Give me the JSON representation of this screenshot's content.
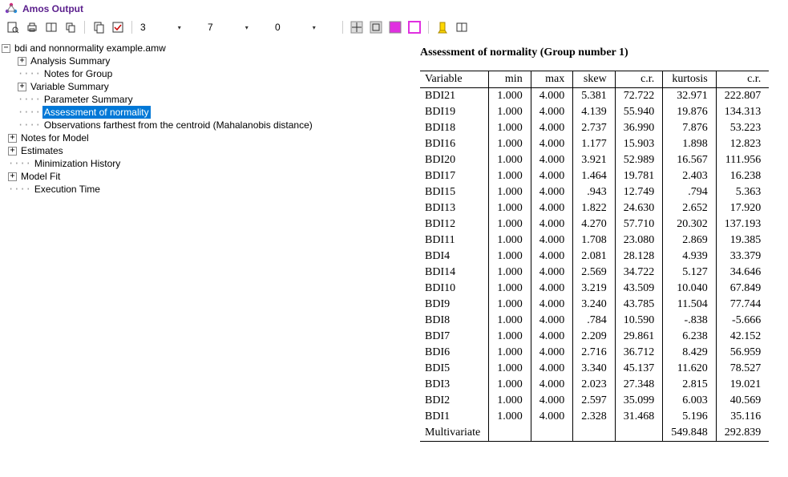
{
  "app": {
    "title": "Amos Output"
  },
  "toolbar": {
    "combo1": "3",
    "combo2": "7",
    "combo3": "0"
  },
  "tree": {
    "root_label": "bdi and nonnormality example.amw",
    "items": [
      {
        "label": "Analysis Summary",
        "indent": 1,
        "exp": "+"
      },
      {
        "label": "Notes for Group",
        "indent": 1,
        "exp": null
      },
      {
        "label": "Variable Summary",
        "indent": 1,
        "exp": "+"
      },
      {
        "label": "Parameter Summary",
        "indent": 1,
        "exp": null
      },
      {
        "label": "Assessment of normality",
        "indent": 1,
        "exp": null,
        "selected": true
      },
      {
        "label": "Observations farthest from the centroid (Mahalanobis distance)",
        "indent": 1,
        "exp": null
      },
      {
        "label": "Notes for Model",
        "indent": 0,
        "exp": "+"
      },
      {
        "label": "Estimates",
        "indent": 0,
        "exp": "+"
      },
      {
        "label": "Minimization History",
        "indent": 0,
        "exp": null
      },
      {
        "label": "Model Fit",
        "indent": 0,
        "exp": "+"
      },
      {
        "label": "Execution Time",
        "indent": 0,
        "exp": null
      }
    ]
  },
  "content": {
    "title": "Assessment of normality (Group number 1)",
    "headers": [
      "Variable",
      "min",
      "max",
      "skew",
      "c.r.",
      "kurtosis",
      "c.r."
    ],
    "rows": [
      [
        "BDI21",
        "1.000",
        "4.000",
        "5.381",
        "72.722",
        "32.971",
        "222.807"
      ],
      [
        "BDI19",
        "1.000",
        "4.000",
        "4.139",
        "55.940",
        "19.876",
        "134.313"
      ],
      [
        "BDI18",
        "1.000",
        "4.000",
        "2.737",
        "36.990",
        "7.876",
        "53.223"
      ],
      [
        "BDI16",
        "1.000",
        "4.000",
        "1.177",
        "15.903",
        "1.898",
        "12.823"
      ],
      [
        "BDI20",
        "1.000",
        "4.000",
        "3.921",
        "52.989",
        "16.567",
        "111.956"
      ],
      [
        "BDI17",
        "1.000",
        "4.000",
        "1.464",
        "19.781",
        "2.403",
        "16.238"
      ],
      [
        "BDI15",
        "1.000",
        "4.000",
        ".943",
        "12.749",
        ".794",
        "5.363"
      ],
      [
        "BDI13",
        "1.000",
        "4.000",
        "1.822",
        "24.630",
        "2.652",
        "17.920"
      ],
      [
        "BDI12",
        "1.000",
        "4.000",
        "4.270",
        "57.710",
        "20.302",
        "137.193"
      ],
      [
        "BDI11",
        "1.000",
        "4.000",
        "1.708",
        "23.080",
        "2.869",
        "19.385"
      ],
      [
        "BDI4",
        "1.000",
        "4.000",
        "2.081",
        "28.128",
        "4.939",
        "33.379"
      ],
      [
        "BDI14",
        "1.000",
        "4.000",
        "2.569",
        "34.722",
        "5.127",
        "34.646"
      ],
      [
        "BDI10",
        "1.000",
        "4.000",
        "3.219",
        "43.509",
        "10.040",
        "67.849"
      ],
      [
        "BDI9",
        "1.000",
        "4.000",
        "3.240",
        "43.785",
        "11.504",
        "77.744"
      ],
      [
        "BDI8",
        "1.000",
        "4.000",
        ".784",
        "10.590",
        "-.838",
        "-5.666"
      ],
      [
        "BDI7",
        "1.000",
        "4.000",
        "2.209",
        "29.861",
        "6.238",
        "42.152"
      ],
      [
        "BDI6",
        "1.000",
        "4.000",
        "2.716",
        "36.712",
        "8.429",
        "56.959"
      ],
      [
        "BDI5",
        "1.000",
        "4.000",
        "3.340",
        "45.137",
        "11.620",
        "78.527"
      ],
      [
        "BDI3",
        "1.000",
        "4.000",
        "2.023",
        "27.348",
        "2.815",
        "19.021"
      ],
      [
        "BDI2",
        "1.000",
        "4.000",
        "2.597",
        "35.099",
        "6.003",
        "40.569"
      ],
      [
        "BDI1",
        "1.000",
        "4.000",
        "2.328",
        "31.468",
        "5.196",
        "35.116"
      ],
      [
        "Multivariate",
        "",
        "",
        "",
        "",
        "549.848",
        "292.839"
      ]
    ]
  },
  "chart_data": {
    "type": "table",
    "title": "Assessment of normality (Group number 1)",
    "columns": [
      "Variable",
      "min",
      "max",
      "skew",
      "c.r.",
      "kurtosis",
      "c.r."
    ],
    "rows": [
      [
        "BDI21",
        1.0,
        4.0,
        5.381,
        72.722,
        32.971,
        222.807
      ],
      [
        "BDI19",
        1.0,
        4.0,
        4.139,
        55.94,
        19.876,
        134.313
      ],
      [
        "BDI18",
        1.0,
        4.0,
        2.737,
        36.99,
        7.876,
        53.223
      ],
      [
        "BDI16",
        1.0,
        4.0,
        1.177,
        15.903,
        1.898,
        12.823
      ],
      [
        "BDI20",
        1.0,
        4.0,
        3.921,
        52.989,
        16.567,
        111.956
      ],
      [
        "BDI17",
        1.0,
        4.0,
        1.464,
        19.781,
        2.403,
        16.238
      ],
      [
        "BDI15",
        1.0,
        4.0,
        0.943,
        12.749,
        0.794,
        5.363
      ],
      [
        "BDI13",
        1.0,
        4.0,
        1.822,
        24.63,
        2.652,
        17.92
      ],
      [
        "BDI12",
        1.0,
        4.0,
        4.27,
        57.71,
        20.302,
        137.193
      ],
      [
        "BDI11",
        1.0,
        4.0,
        1.708,
        23.08,
        2.869,
        19.385
      ],
      [
        "BDI4",
        1.0,
        4.0,
        2.081,
        28.128,
        4.939,
        33.379
      ],
      [
        "BDI14",
        1.0,
        4.0,
        2.569,
        34.722,
        5.127,
        34.646
      ],
      [
        "BDI10",
        1.0,
        4.0,
        3.219,
        43.509,
        10.04,
        67.849
      ],
      [
        "BDI9",
        1.0,
        4.0,
        3.24,
        43.785,
        11.504,
        77.744
      ],
      [
        "BDI8",
        1.0,
        4.0,
        0.784,
        10.59,
        -0.838,
        -5.666
      ],
      [
        "BDI7",
        1.0,
        4.0,
        2.209,
        29.861,
        6.238,
        42.152
      ],
      [
        "BDI6",
        1.0,
        4.0,
        2.716,
        36.712,
        8.429,
        56.959
      ],
      [
        "BDI5",
        1.0,
        4.0,
        3.34,
        45.137,
        11.62,
        78.527
      ],
      [
        "BDI3",
        1.0,
        4.0,
        2.023,
        27.348,
        2.815,
        19.021
      ],
      [
        "BDI2",
        1.0,
        4.0,
        2.597,
        35.099,
        6.003,
        40.569
      ],
      [
        "BDI1",
        1.0,
        4.0,
        2.328,
        31.468,
        5.196,
        35.116
      ],
      [
        "Multivariate",
        null,
        null,
        null,
        null,
        549.848,
        292.839
      ]
    ]
  }
}
